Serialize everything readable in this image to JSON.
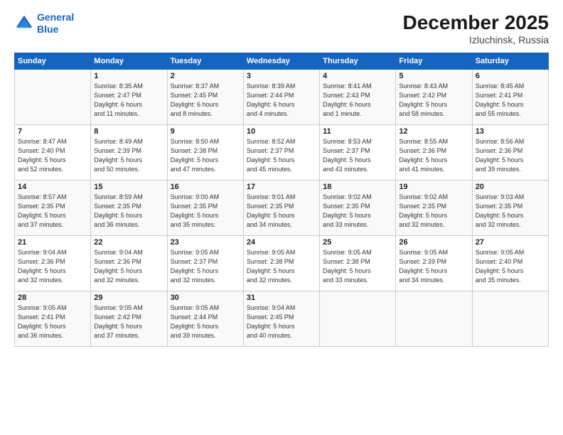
{
  "header": {
    "logo_line1": "General",
    "logo_line2": "Blue",
    "month_year": "December 2025",
    "location": "Izluchinsk, Russia"
  },
  "days_of_week": [
    "Sunday",
    "Monday",
    "Tuesday",
    "Wednesday",
    "Thursday",
    "Friday",
    "Saturday"
  ],
  "weeks": [
    [
      {
        "day": "",
        "info": ""
      },
      {
        "day": "1",
        "info": "Sunrise: 8:35 AM\nSunset: 2:47 PM\nDaylight: 6 hours\nand 11 minutes."
      },
      {
        "day": "2",
        "info": "Sunrise: 8:37 AM\nSunset: 2:45 PM\nDaylight: 6 hours\nand 8 minutes."
      },
      {
        "day": "3",
        "info": "Sunrise: 8:39 AM\nSunset: 2:44 PM\nDaylight: 6 hours\nand 4 minutes."
      },
      {
        "day": "4",
        "info": "Sunrise: 8:41 AM\nSunset: 2:43 PM\nDaylight: 6 hours\nand 1 minute."
      },
      {
        "day": "5",
        "info": "Sunrise: 8:43 AM\nSunset: 2:42 PM\nDaylight: 5 hours\nand 58 minutes."
      },
      {
        "day": "6",
        "info": "Sunrise: 8:45 AM\nSunset: 2:41 PM\nDaylight: 5 hours\nand 55 minutes."
      }
    ],
    [
      {
        "day": "7",
        "info": "Sunrise: 8:47 AM\nSunset: 2:40 PM\nDaylight: 5 hours\nand 52 minutes."
      },
      {
        "day": "8",
        "info": "Sunrise: 8:49 AM\nSunset: 2:39 PM\nDaylight: 5 hours\nand 50 minutes."
      },
      {
        "day": "9",
        "info": "Sunrise: 8:50 AM\nSunset: 2:38 PM\nDaylight: 5 hours\nand 47 minutes."
      },
      {
        "day": "10",
        "info": "Sunrise: 8:52 AM\nSunset: 2:37 PM\nDaylight: 5 hours\nand 45 minutes."
      },
      {
        "day": "11",
        "info": "Sunrise: 8:53 AM\nSunset: 2:37 PM\nDaylight: 5 hours\nand 43 minutes."
      },
      {
        "day": "12",
        "info": "Sunrise: 8:55 AM\nSunset: 2:36 PM\nDaylight: 5 hours\nand 41 minutes."
      },
      {
        "day": "13",
        "info": "Sunrise: 8:56 AM\nSunset: 2:36 PM\nDaylight: 5 hours\nand 39 minutes."
      }
    ],
    [
      {
        "day": "14",
        "info": "Sunrise: 8:57 AM\nSunset: 2:35 PM\nDaylight: 5 hours\nand 37 minutes."
      },
      {
        "day": "15",
        "info": "Sunrise: 8:59 AM\nSunset: 2:35 PM\nDaylight: 5 hours\nand 36 minutes."
      },
      {
        "day": "16",
        "info": "Sunrise: 9:00 AM\nSunset: 2:35 PM\nDaylight: 5 hours\nand 35 minutes."
      },
      {
        "day": "17",
        "info": "Sunrise: 9:01 AM\nSunset: 2:35 PM\nDaylight: 5 hours\nand 34 minutes."
      },
      {
        "day": "18",
        "info": "Sunrise: 9:02 AM\nSunset: 2:35 PM\nDaylight: 5 hours\nand 33 minutes."
      },
      {
        "day": "19",
        "info": "Sunrise: 9:02 AM\nSunset: 2:35 PM\nDaylight: 5 hours\nand 32 minutes."
      },
      {
        "day": "20",
        "info": "Sunrise: 9:03 AM\nSunset: 2:35 PM\nDaylight: 5 hours\nand 32 minutes."
      }
    ],
    [
      {
        "day": "21",
        "info": "Sunrise: 9:04 AM\nSunset: 2:36 PM\nDaylight: 5 hours\nand 32 minutes."
      },
      {
        "day": "22",
        "info": "Sunrise: 9:04 AM\nSunset: 2:36 PM\nDaylight: 5 hours\nand 32 minutes."
      },
      {
        "day": "23",
        "info": "Sunrise: 9:05 AM\nSunset: 2:37 PM\nDaylight: 5 hours\nand 32 minutes."
      },
      {
        "day": "24",
        "info": "Sunrise: 9:05 AM\nSunset: 2:38 PM\nDaylight: 5 hours\nand 32 minutes."
      },
      {
        "day": "25",
        "info": "Sunrise: 9:05 AM\nSunset: 2:38 PM\nDaylight: 5 hours\nand 33 minutes."
      },
      {
        "day": "26",
        "info": "Sunrise: 9:05 AM\nSunset: 2:39 PM\nDaylight: 5 hours\nand 34 minutes."
      },
      {
        "day": "27",
        "info": "Sunrise: 9:05 AM\nSunset: 2:40 PM\nDaylight: 5 hours\nand 35 minutes."
      }
    ],
    [
      {
        "day": "28",
        "info": "Sunrise: 9:05 AM\nSunset: 2:41 PM\nDaylight: 5 hours\nand 36 minutes."
      },
      {
        "day": "29",
        "info": "Sunrise: 9:05 AM\nSunset: 2:42 PM\nDaylight: 5 hours\nand 37 minutes."
      },
      {
        "day": "30",
        "info": "Sunrise: 9:05 AM\nSunset: 2:44 PM\nDaylight: 5 hours\nand 39 minutes."
      },
      {
        "day": "31",
        "info": "Sunrise: 9:04 AM\nSunset: 2:45 PM\nDaylight: 5 hours\nand 40 minutes."
      },
      {
        "day": "",
        "info": ""
      },
      {
        "day": "",
        "info": ""
      },
      {
        "day": "",
        "info": ""
      }
    ]
  ]
}
